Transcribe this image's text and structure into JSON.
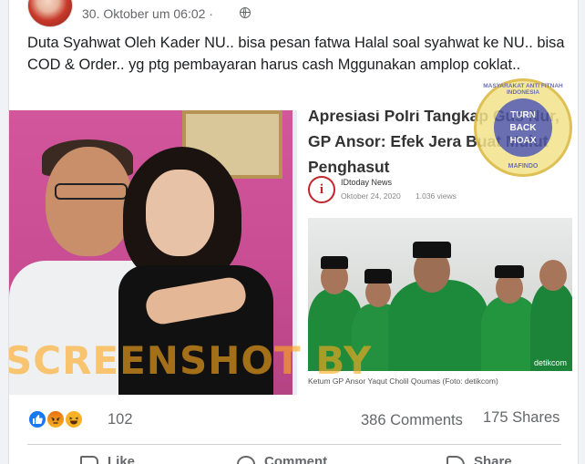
{
  "post": {
    "timestamp": "30. Oktober um 06:02 ·",
    "text": "Duta Syahwat Oleh Kader NU..  bisa pesan fatwa Halal soal syahwat ke NU.. bisa COD & Order.. yg ptg pembayaran harus cash Mggunakan amplop coklat.."
  },
  "image": {
    "watermark": "SCREENSHOT BY",
    "news": {
      "headline": "Apresiasi Polri Tangkap Gus Nur, GP Ansor: Efek Jera Buat Mulut Penghasut",
      "logo": "i",
      "source": "IDtoday News",
      "date": "Oktober 24, 2020",
      "views": "1.036 views",
      "caption": "Ketum GP Ansor Yaqut Cholil Qoumas (Foto: detikcom)",
      "photo_credit": "detikcom"
    },
    "stamp": {
      "ring_top": "MASYARAKAT ANTI FITNAH INDONESIA",
      "center_line1": "TURN",
      "center_line2": "BACK",
      "center_line3": "HOAX",
      "ring_bottom": "MAFINDO"
    }
  },
  "stats": {
    "reactions": [
      "like-icon",
      "angry-icon",
      "haha-icon"
    ],
    "reaction_count": "102",
    "comments": "386 Comments",
    "shares": "175 Shares"
  },
  "actions": {
    "like": "Like",
    "comment": "Comment",
    "share": "Share"
  },
  "colors": {
    "like_blue": "#1877f2",
    "watermark_orange": "#ffaa1e",
    "stamp_yellow": "#f3e38a"
  }
}
